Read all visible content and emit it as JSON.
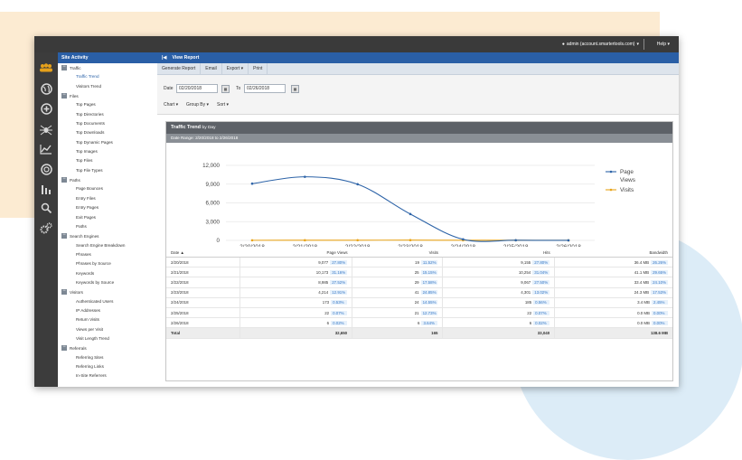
{
  "topbar": {
    "user": "admin (account.smartertools.com)",
    "help": "Help"
  },
  "iconbar": [
    {
      "icon": "users-icon",
      "color": "#e6a11a"
    },
    {
      "icon": "globe-icon"
    },
    {
      "icon": "plus-circle-icon"
    },
    {
      "icon": "spider-icon"
    },
    {
      "icon": "line-chart-icon"
    },
    {
      "icon": "gauge-icon"
    },
    {
      "icon": "bar-chart-icon"
    },
    {
      "icon": "search-icon"
    },
    {
      "icon": "gears-icon"
    }
  ],
  "sidebar": {
    "title": "Site Activity",
    "groups": [
      {
        "label": "Traffic",
        "items": [
          {
            "label": "Traffic Trend",
            "selected": true
          },
          {
            "label": "Visitors Trend"
          }
        ]
      },
      {
        "label": "Files",
        "items": [
          {
            "label": "Top Pages"
          },
          {
            "label": "Top Directories"
          },
          {
            "label": "Top Documents"
          },
          {
            "label": "Top Downloads"
          },
          {
            "label": "Top Dynamic Pages"
          },
          {
            "label": "Top Images"
          },
          {
            "label": "Top Files"
          },
          {
            "label": "Top File Types"
          }
        ]
      },
      {
        "label": "Paths",
        "items": [
          {
            "label": "Page Bounces"
          },
          {
            "label": "Entry Files"
          },
          {
            "label": "Entry Pages"
          },
          {
            "label": "Exit Pages"
          },
          {
            "label": "Paths"
          }
        ]
      },
      {
        "label": "Search Engines",
        "items": [
          {
            "label": "Search Engine Breakdown"
          },
          {
            "label": "Phrases"
          },
          {
            "label": "Phrases by Source"
          },
          {
            "label": "Keywords"
          },
          {
            "label": "Keywords by Source"
          }
        ]
      },
      {
        "label": "Visitors",
        "items": [
          {
            "label": "Authenticated Users"
          },
          {
            "label": "IP Addresses"
          },
          {
            "label": "Return Visits"
          },
          {
            "label": "Views per Visit"
          },
          {
            "label": "Visit Length Trend"
          }
        ]
      },
      {
        "label": "Referrals",
        "items": [
          {
            "label": "Referring Sites"
          },
          {
            "label": "Referring Links"
          },
          {
            "label": "In-Site Referrers"
          }
        ]
      }
    ]
  },
  "main": {
    "view_title": "View Report",
    "toolbar": [
      "Generate Report",
      "Email",
      "Export ▾",
      "Print"
    ],
    "date_label": "Date",
    "date_from": "02/20/2018",
    "to_label": "To",
    "date_to": "02/26/2018",
    "dropdowns": [
      "Chart ▾",
      "Group By ▾",
      "Sort ▾"
    ]
  },
  "report": {
    "title": "Traffic Trend",
    "title_suffix": "by Day",
    "date_range": "Date Range: 2/20/2018 to 2/26/2018",
    "columns": [
      "Date ▲",
      "Page Views",
      "Visits",
      "Hits",
      "Bandwidth"
    ],
    "rows": [
      {
        "date": "2/20/2018",
        "pv": "9,077",
        "pv_pct": "27.80%",
        "visits": "19",
        "visits_pct": "11.52%",
        "hits": "9,155",
        "hits_pct": "27.80%",
        "bw": "36.4 MB",
        "bw_pct": "26.26%"
      },
      {
        "date": "2/21/2018",
        "pv": "10,173",
        "pv_pct": "31.16%",
        "visits": "25",
        "visits_pct": "15.15%",
        "hits": "10,254",
        "hits_pct": "31.04%",
        "bw": "41.1 MB",
        "bw_pct": "29.65%"
      },
      {
        "date": "2/22/2018",
        "pv": "8,985",
        "pv_pct": "27.52%",
        "visits": "29",
        "visits_pct": "17.58%",
        "hits": "9,067",
        "hits_pct": "27.50%",
        "bw": "33.4 MB",
        "bw_pct": "24.10%"
      },
      {
        "date": "2/23/2018",
        "pv": "4,214",
        "pv_pct": "12.91%",
        "visits": "41",
        "visits_pct": "24.85%",
        "hits": "4,301",
        "hits_pct": "13.02%",
        "bw": "24.3 MB",
        "bw_pct": "17.53%"
      },
      {
        "date": "2/24/2018",
        "pv": "173",
        "pv_pct": "0.53%",
        "visits": "24",
        "visits_pct": "14.55%",
        "hits": "185",
        "hits_pct": "0.56%",
        "bw": "3.4 MB",
        "bw_pct": "2.45%"
      },
      {
        "date": "2/25/2018",
        "pv": "22",
        "pv_pct": "0.07%",
        "visits": "21",
        "visits_pct": "12.73%",
        "hits": "22",
        "hits_pct": "0.07%",
        "bw": "0.0 MB",
        "bw_pct": "0.00%"
      },
      {
        "date": "2/26/2018",
        "pv": "6",
        "pv_pct": "0.02%",
        "visits": "6",
        "visits_pct": "3.64%",
        "hits": "6",
        "hits_pct": "0.02%",
        "bw": "0.0 MB",
        "bw_pct": "0.00%"
      }
    ],
    "total": {
      "label": "Total",
      "pv": "32,650",
      "visits": "165",
      "hits": "33,040",
      "bw": "138.6 MB"
    }
  },
  "chart_data": {
    "type": "line",
    "title": "",
    "xlabel": "",
    "ylabel": "",
    "categories": [
      "2/20/2018",
      "2/21/2018",
      "2/22/2018",
      "2/23/2018",
      "2/24/2018",
      "2/25/2018",
      "2/26/2018"
    ],
    "ylim": [
      0,
      12000
    ],
    "yticks": [
      0,
      3000,
      6000,
      9000,
      12000
    ],
    "ytick_labels": [
      "0",
      "3,000",
      "6,000",
      "9,000",
      "12,000"
    ],
    "series": [
      {
        "name": "Page Views",
        "values": [
          9077,
          10173,
          8985,
          4214,
          173,
          22,
          6
        ],
        "color": "#2e64a8"
      },
      {
        "name": "Visits",
        "values": [
          19,
          25,
          29,
          41,
          24,
          21,
          6
        ],
        "color": "#e8a41a"
      }
    ],
    "legend": "right",
    "grid": true
  }
}
